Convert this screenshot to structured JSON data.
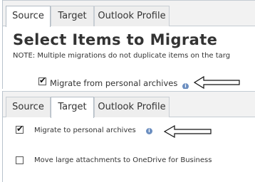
{
  "top_panel": {
    "tabs": [
      {
        "label": "Source",
        "active": true
      },
      {
        "label": "Target",
        "active": false
      },
      {
        "label": "Outlook Profile",
        "active": false
      }
    ],
    "title": "Select Items to Migrate",
    "note": "NOTE: Multiple migrations do not duplicate items on the targ",
    "option": {
      "label": "Migrate from personal archives",
      "checked": true
    }
  },
  "bottom_panel": {
    "tabs": [
      {
        "label": "Source",
        "active": false
      },
      {
        "label": "Target",
        "active": true
      },
      {
        "label": "Outlook Profile",
        "active": false
      }
    ],
    "options": [
      {
        "label": "Migrate to personal archives",
        "checked": true
      },
      {
        "label": "Move large attachments to OneDrive for Business",
        "checked": false
      }
    ]
  },
  "icons": {
    "info": "info-icon",
    "arrow": "left-arrow-icon",
    "check": "checkmark-icon"
  },
  "colors": {
    "info_icon": "#6b8ec0",
    "tab_border": "#c4ccd3",
    "text": "#333333"
  }
}
